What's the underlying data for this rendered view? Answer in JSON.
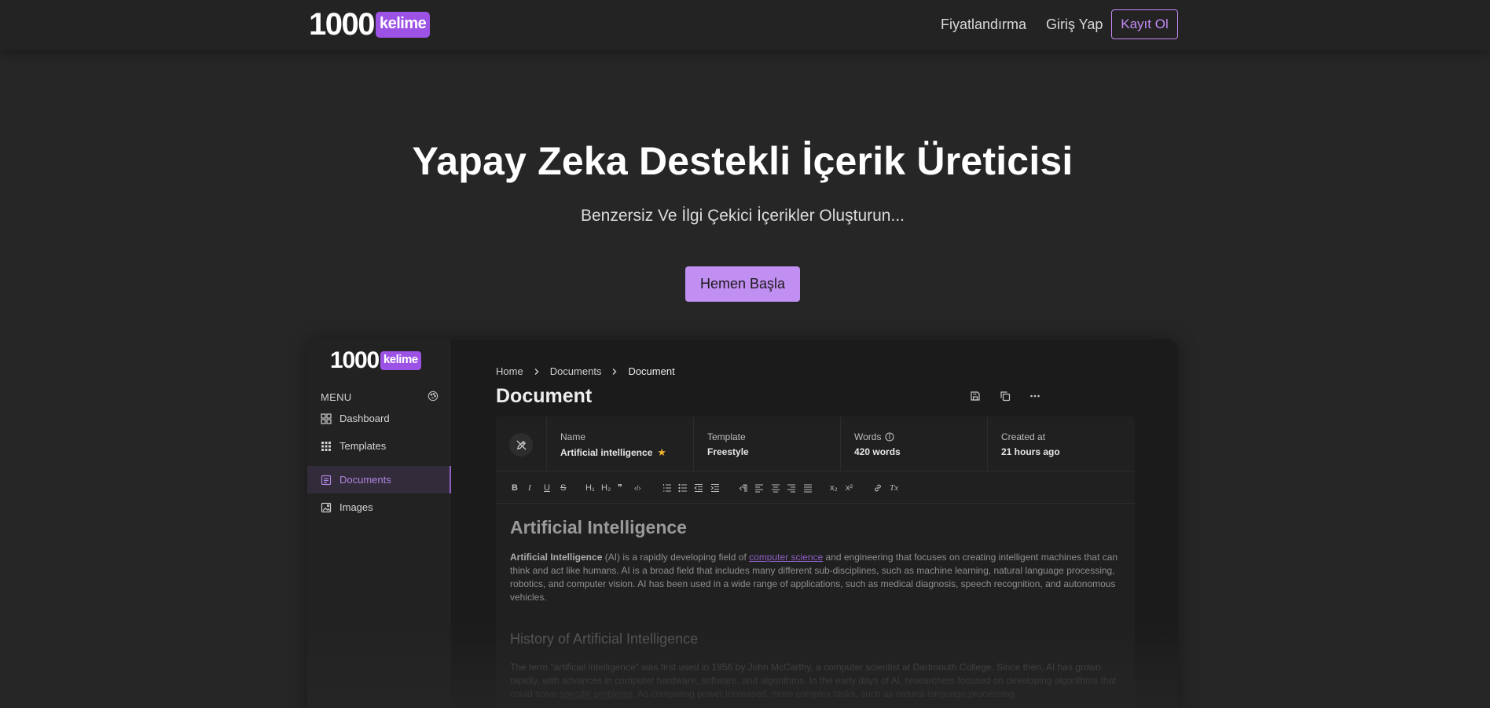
{
  "nav": {
    "logo_number": "1000",
    "logo_word": "kelime",
    "pricing": "Fiyatlandırma",
    "login": "Giriş Yap",
    "signup": "Kayıt Ol"
  },
  "hero": {
    "title": "Yapay Zeka Destekli İçerik Üreticisi",
    "subtitle": "Benzersiz Ve İlgi Çekici İçerikler Oluşturun...",
    "cta": "Hemen Başla"
  },
  "app": {
    "logo_number": "1000",
    "logo_word": "kelime",
    "menu_label": "MENU",
    "menu_items": [
      {
        "label": "Dashboard",
        "icon": "dashboard-icon"
      },
      {
        "label": "Templates",
        "icon": "grid-icon"
      },
      {
        "label": "Documents",
        "icon": "document-icon"
      },
      {
        "label": "Images",
        "icon": "image-icon"
      }
    ],
    "active_item": "Documents",
    "breadcrumbs": [
      "Home",
      "Documents",
      "Document"
    ],
    "page_title": "Document",
    "meta": {
      "name_label": "Name",
      "name_value": "Artificial intelligence",
      "template_label": "Template",
      "template_value": "Freestyle",
      "words_label": "Words",
      "words_value": "420 words",
      "created_label": "Created at",
      "created_value": "21 hours ago"
    },
    "toolbar_labels": {
      "bold": "B",
      "italic": "I",
      "underline": "U",
      "strike": "S",
      "h1": "H₁",
      "h2": "H₂",
      "quote": "❞",
      "code": "‹/›",
      "subscript": "x₂",
      "superscript": "x²",
      "clear_format": "Tx"
    },
    "doc": {
      "heading": "Artificial Intelligence",
      "p1_bold": "Artificial Intelligence",
      "p1_a": " (AI) is a rapidly developing field of ",
      "p1_link": "computer science",
      "p1_b": " and engineering that focuses on creating intelligent machines that can think and act like humans. AI is a broad field that includes many different sub-disciplines, such as machine learning, natural language processing, robotics, and computer vision. AI has been used in a wide range of applications, such as medical diagnosis, speech recognition, and autonomous vehicles.",
      "heading2": "History of Artificial Intelligence",
      "p2_a": "The term \"artificial intelligence\" was first used in 1956 by John McCarthy, a computer scientist at Dartmouth College. Since then, AI has grown rapidly, with advances in computer hardware, software, and algorithms. In the early days of AI, researchers focused on developing algorithms that could solve ",
      "p2_link": "specific problems",
      "p2_b": ". As computing power increased, more complex tasks, such as natural language processing,"
    }
  },
  "colors": {
    "brand_purple": "#9d52e6",
    "cta": "#c18ef2",
    "accent_outline": "#c58bf5",
    "star": "#f2b531",
    "background": "#262626"
  }
}
